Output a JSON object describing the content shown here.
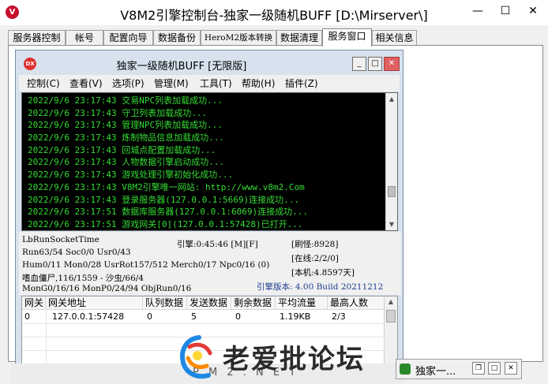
{
  "window": {
    "title": "V8M2引擎控制台-独家一级随机BUFF [D:\\Mirserver\\]",
    "app_icon": "V",
    "min_glyph": "—",
    "max_glyph": "☐",
    "close_glyph": "✕"
  },
  "tabs": [
    {
      "label": "服务器控制"
    },
    {
      "label": "帐号"
    },
    {
      "label": "配置向导"
    },
    {
      "label": "数据备份"
    },
    {
      "label": "HeroM2版本转换"
    },
    {
      "label": "数据清理"
    },
    {
      "label": "服务窗口"
    },
    {
      "label": "相关信息"
    }
  ],
  "inner_window": {
    "title": "独家一级随机BUFF [无限版]",
    "icon_label": "DX",
    "min_glyph": "_",
    "max_glyph": "□",
    "close_glyph": "✕",
    "menus": [
      "控制(C)",
      "查看(V)",
      "选项(P)",
      "管理(M)",
      "工具(T)",
      "帮助(H)",
      "插件(Z)"
    ]
  },
  "log": [
    "2022/9/6 23:17:43 交易NPC列表加载成功...",
    "2022/9/6 23:17:43 守卫列表加载成功...",
    "2022/9/6 23:17:43 管理NPC列表加载成功...",
    "2022/9/6 23:17:43 炼制物品信息加载成功...",
    "2022/9/6 23:17:43 回城点配置加载成功...",
    "2022/9/6 23:17:43 人物数据引擎启动成功...",
    "2022/9/6 23:17:43 游戏处理引擎初始化成功...",
    "2022/9/6 23:17:43 V8M2引擎唯一网站: http://www.v8m2.Com",
    "2022/9/6 23:17:43 登录服务器(127.0.0.1:5669)连接成功...",
    "2022/9/6 23:17:51 数据库服务器(127.0.0.1:6069)连接成功...",
    "2022/9/6 23:17:51 游戏网关[0](127.0.0.1:57428)已打开..."
  ],
  "status": {
    "socket_time": "LbRunSocketTime",
    "run": "Run63/54 Soc0/0 Usr0/43",
    "engine": "引擎:0:45:46 [M][F]",
    "refresh": "[刷怪:8928]",
    "hum": "Hum0/11 Mon0/28 UsrRot157/512 Merch0/17 Npc0/16 (0)",
    "online": "[在线:2/2/0]",
    "monster": "嗜血僵尸,116/1559 - 沙虫/66/4",
    "version_no": "[本机:4.8597天]",
    "mongo": "MonG0/16/16 MonP0/24/94 ObjRun0/16",
    "engine_version": "引擎版本: 4.00 Build 20211212"
  },
  "gate_table": {
    "columns": [
      "网关",
      "网关地址",
      "队列数据",
      "发送数据",
      "剩余数据",
      "平均流量",
      "最高人数"
    ],
    "rows": [
      [
        "0",
        "127.0.0.1:57428",
        "0",
        "5",
        "0",
        "1.19KB",
        "2/3"
      ]
    ]
  },
  "taskbar": {
    "strip_text": "P M 2 . N E T",
    "window_label": "独家一...",
    "restore_glyph": "❐",
    "max_glyph": "□",
    "close_glyph": "✕"
  },
  "watermark": {
    "text": "老爱批论坛"
  },
  "colors": {
    "console_bg": "#000000",
    "log_text": "#33dd33",
    "inner_frame": "#d7e2ee",
    "accent_blue": "#1f3f8f"
  },
  "icons": {
    "scroll_up": "▲",
    "scroll_down": "▼"
  }
}
